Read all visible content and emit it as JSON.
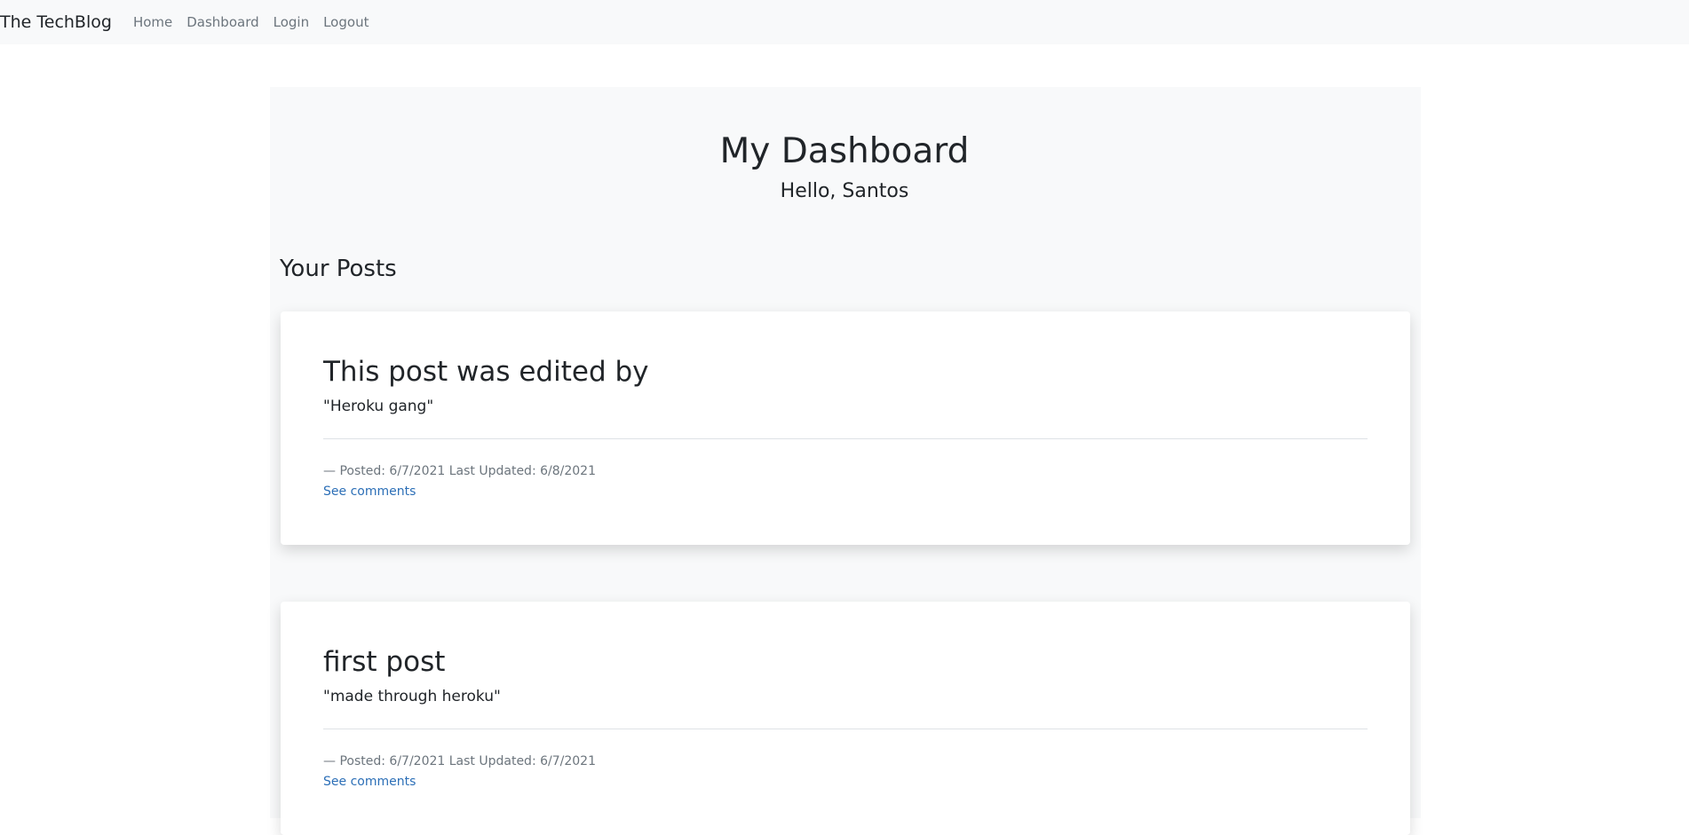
{
  "navbar": {
    "brand": "The TechBlog",
    "links": [
      "Home",
      "Dashboard",
      "Login",
      "Logout"
    ]
  },
  "dashboard": {
    "title": "My Dashboard",
    "greeting": "Hello, Santos",
    "section_title": "Your Posts"
  },
  "posts": [
    {
      "title": "This post was edited by",
      "content": "\"Heroku gang\"",
      "meta": "—  Posted: 6/7/2021 Last Updated: 6/8/2021",
      "link_label": "See comments"
    },
    {
      "title": "first post",
      "content": "\"made through heroku\"",
      "meta": "—  Posted: 6/7/2021 Last Updated: 6/7/2021",
      "link_label": "See comments"
    }
  ],
  "colors": {
    "navbar_bg": "#f8f9fa",
    "jumbotron_bg": "#f8f9fa",
    "link": "#2c6fb7",
    "muted": "#6c757d"
  }
}
